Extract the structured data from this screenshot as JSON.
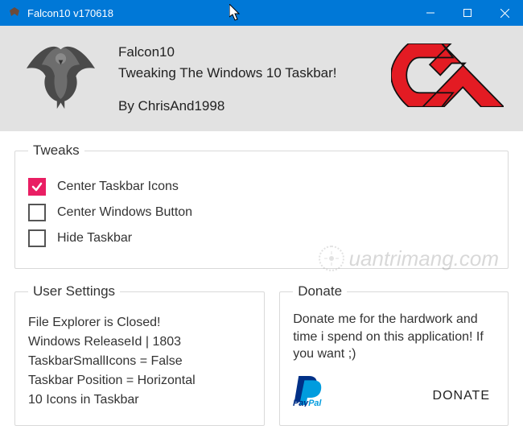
{
  "window": {
    "title": "Falcon10 v170618",
    "accent": "#0078d7"
  },
  "header": {
    "app_name": "Falcon10",
    "tagline": "Tweaking The Windows 10 Taskbar!",
    "byline": "By ChrisAnd1998",
    "logo_accent": "#e31b23"
  },
  "tweaks": {
    "legend": "Tweaks",
    "items": [
      {
        "label": "Center Taskbar Icons",
        "checked": true
      },
      {
        "label": "Center Windows Button",
        "checked": false
      },
      {
        "label": "Hide Taskbar",
        "checked": false
      }
    ],
    "check_color": "#e91e63"
  },
  "user_settings": {
    "legend": "User Settings",
    "lines": [
      "File Explorer is Closed!",
      "Windows ReleaseId | 1803",
      "TaskbarSmallIcons = False",
      "Taskbar Position = Horizontal",
      "10 Icons in Taskbar"
    ]
  },
  "donate": {
    "legend": "Donate",
    "text": "Donate me for the hardwork and time i spend on this application! If you want ;)",
    "paypal_label": "PayPal",
    "button": "DONATE"
  },
  "watermark": {
    "text": "uantrimang.com"
  }
}
